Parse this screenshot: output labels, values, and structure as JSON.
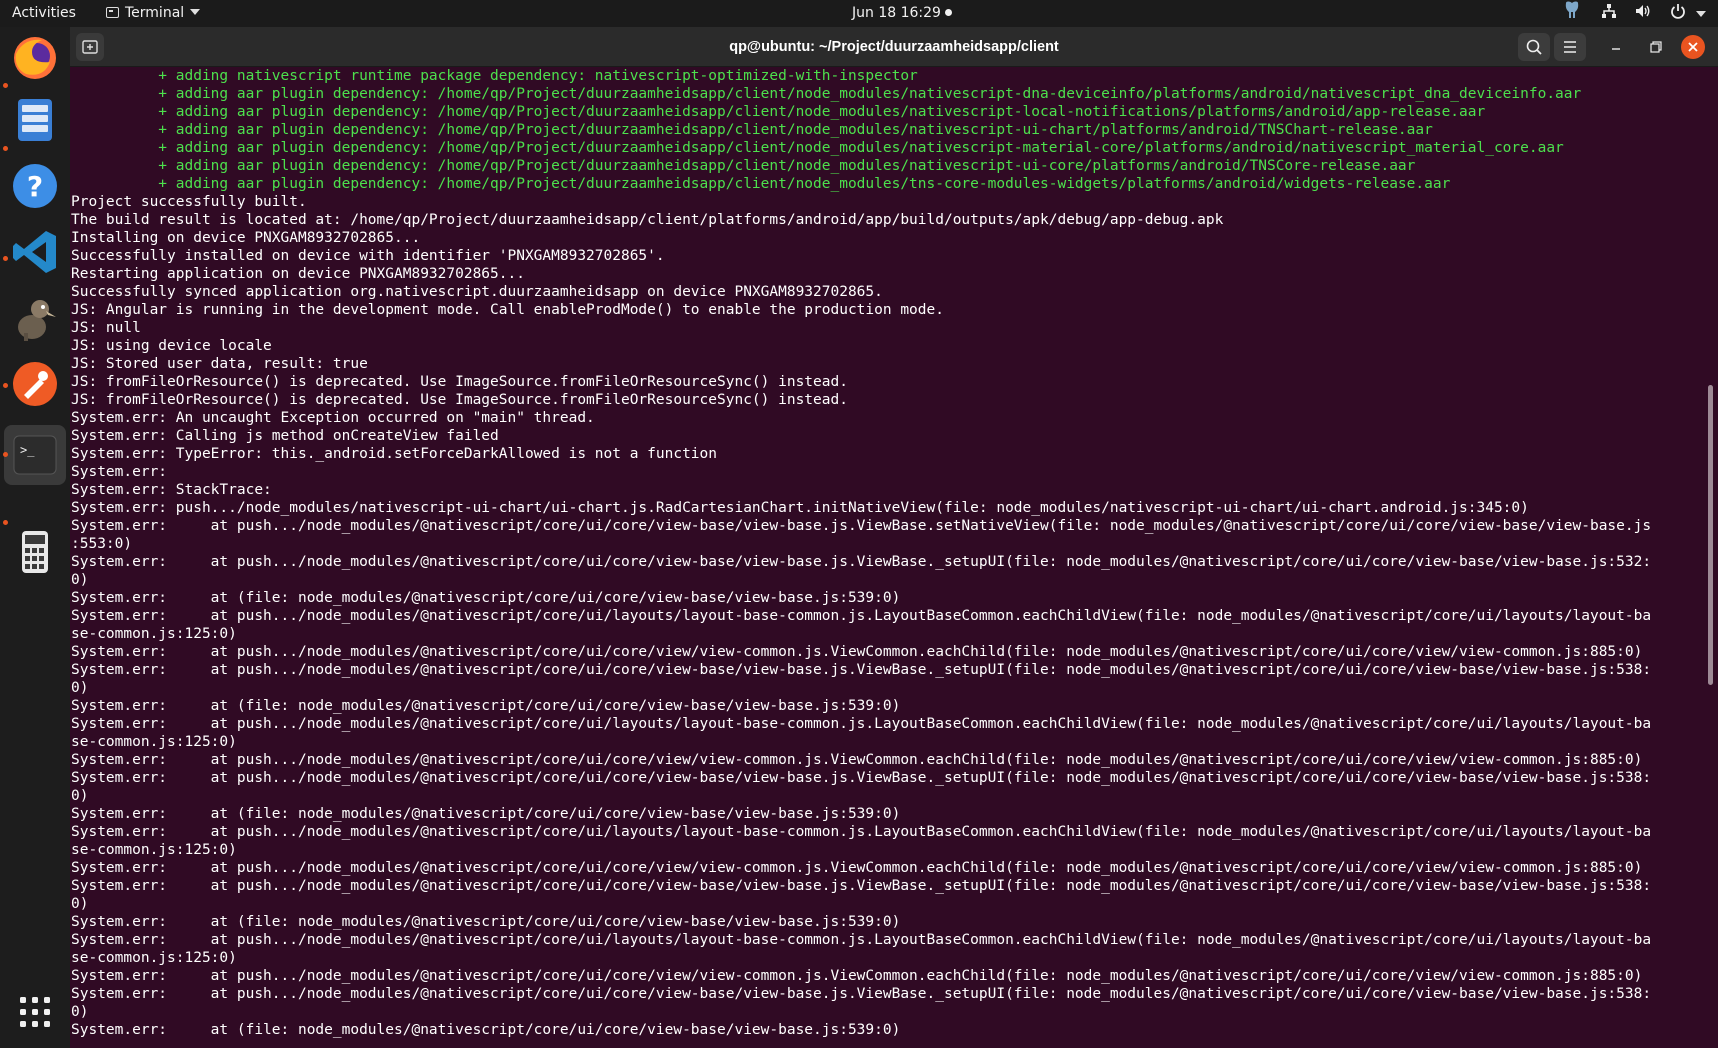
{
  "topbar": {
    "activities": "Activities",
    "app_menu": "Terminal",
    "clock": "Jun 18  16:29"
  },
  "dock": {
    "items": [
      {
        "name": "firefox-icon"
      },
      {
        "name": "files-icon"
      },
      {
        "name": "help-icon"
      },
      {
        "name": "vscode-icon"
      },
      {
        "name": "gimp-icon"
      },
      {
        "name": "postman-icon"
      },
      {
        "name": "terminal-icon"
      },
      {
        "name": "calculator-icon"
      }
    ],
    "show_apps": "show-applications-icon"
  },
  "window": {
    "title": "qp@ubuntu: ~/Project/duurzaamheidsapp/client"
  },
  "colors": {
    "terminal_bg": "#300a24",
    "accent": "#e95420",
    "green_text": "#4de04d"
  },
  "terminal": {
    "lines": [
      {
        "t": "          + adding nativescript runtime package dependency: nativescript-optimized-with-inspector",
        "c": "green"
      },
      {
        "t": "          + adding aar plugin dependency: /home/qp/Project/duurzaamheidsapp/client/node_modules/nativescript-dna-deviceinfo/platforms/android/nativescript_dna_deviceinfo.aar",
        "c": "green"
      },
      {
        "t": "          + adding aar plugin dependency: /home/qp/Project/duurzaamheidsapp/client/node_modules/nativescript-local-notifications/platforms/android/app-release.aar",
        "c": "green"
      },
      {
        "t": "          + adding aar plugin dependency: /home/qp/Project/duurzaamheidsapp/client/node_modules/nativescript-ui-chart/platforms/android/TNSChart-release.aar",
        "c": "green"
      },
      {
        "t": "          + adding aar plugin dependency: /home/qp/Project/duurzaamheidsapp/client/node_modules/nativescript-material-core/platforms/android/nativescript_material_core.aar",
        "c": "green"
      },
      {
        "t": "          + adding aar plugin dependency: /home/qp/Project/duurzaamheidsapp/client/node_modules/nativescript-ui-core/platforms/android/TNSCore-release.aar",
        "c": "green"
      },
      {
        "t": "          + adding aar plugin dependency: /home/qp/Project/duurzaamheidsapp/client/node_modules/tns-core-modules-widgets/platforms/android/widgets-release.aar",
        "c": "green"
      },
      {
        "t": "Project successfully built.",
        "c": "white"
      },
      {
        "t": "The build result is located at: /home/qp/Project/duurzaamheidsapp/client/platforms/android/app/build/outputs/apk/debug/app-debug.apk",
        "c": "white"
      },
      {
        "t": "Installing on device PNXGAM8932702865...",
        "c": "white"
      },
      {
        "t": "Successfully installed on device with identifier 'PNXGAM8932702865'.",
        "c": "white"
      },
      {
        "t": "Restarting application on device PNXGAM8932702865...",
        "c": "white"
      },
      {
        "t": "Successfully synced application org.nativescript.duurzaamheidsapp on device PNXGAM8932702865.",
        "c": "white"
      },
      {
        "t": "JS: Angular is running in the development mode. Call enableProdMode() to enable the production mode.",
        "c": "white"
      },
      {
        "t": "JS: null",
        "c": "white"
      },
      {
        "t": "JS: using device locale",
        "c": "white"
      },
      {
        "t": "JS: Stored user data, result: true",
        "c": "white"
      },
      {
        "t": "JS: fromFileOrResource() is deprecated. Use ImageSource.fromFileOrResourceSync() instead.",
        "c": "white"
      },
      {
        "t": "JS: fromFileOrResource() is deprecated. Use ImageSource.fromFileOrResourceSync() instead.",
        "c": "white"
      },
      {
        "t": "System.err: An uncaught Exception occurred on \"main\" thread.",
        "c": "white"
      },
      {
        "t": "System.err: Calling js method onCreateView failed",
        "c": "white"
      },
      {
        "t": "System.err: TypeError: this._android.setForceDarkAllowed is not a function",
        "c": "white"
      },
      {
        "t": "System.err:",
        "c": "white"
      },
      {
        "t": "System.err: StackTrace:",
        "c": "white"
      },
      {
        "t": "System.err: push.../node_modules/nativescript-ui-chart/ui-chart.js.RadCartesianChart.initNativeView(file: node_modules/nativescript-ui-chart/ui-chart.android.js:345:0)",
        "c": "white"
      },
      {
        "t": "System.err:     at push.../node_modules/@nativescript/core/ui/core/view-base/view-base.js.ViewBase.setNativeView(file: node_modules/@nativescript/core/ui/core/view-base/view-base.js",
        "c": "white"
      },
      {
        "t": ":553:0)",
        "c": "white"
      },
      {
        "t": "System.err:     at push.../node_modules/@nativescript/core/ui/core/view-base/view-base.js.ViewBase._setupUI(file: node_modules/@nativescript/core/ui/core/view-base/view-base.js:532:",
        "c": "white"
      },
      {
        "t": "0)",
        "c": "white"
      },
      {
        "t": "System.err:     at (file: node_modules/@nativescript/core/ui/core/view-base/view-base.js:539:0)",
        "c": "white"
      },
      {
        "t": "System.err:     at push.../node_modules/@nativescript/core/ui/layouts/layout-base-common.js.LayoutBaseCommon.eachChildView(file: node_modules/@nativescript/core/ui/layouts/layout-ba",
        "c": "white"
      },
      {
        "t": "se-common.js:125:0)",
        "c": "white"
      },
      {
        "t": "System.err:     at push.../node_modules/@nativescript/core/ui/core/view/view-common.js.ViewCommon.eachChild(file: node_modules/@nativescript/core/ui/core/view/view-common.js:885:0)",
        "c": "white"
      },
      {
        "t": "System.err:     at push.../node_modules/@nativescript/core/ui/core/view-base/view-base.js.ViewBase._setupUI(file: node_modules/@nativescript/core/ui/core/view-base/view-base.js:538:",
        "c": "white"
      },
      {
        "t": "0)",
        "c": "white"
      },
      {
        "t": "System.err:     at (file: node_modules/@nativescript/core/ui/core/view-base/view-base.js:539:0)",
        "c": "white"
      },
      {
        "t": "System.err:     at push.../node_modules/@nativescript/core/ui/layouts/layout-base-common.js.LayoutBaseCommon.eachChildView(file: node_modules/@nativescript/core/ui/layouts/layout-ba",
        "c": "white"
      },
      {
        "t": "se-common.js:125:0)",
        "c": "white"
      },
      {
        "t": "System.err:     at push.../node_modules/@nativescript/core/ui/core/view/view-common.js.ViewCommon.eachChild(file: node_modules/@nativescript/core/ui/core/view/view-common.js:885:0)",
        "c": "white"
      },
      {
        "t": "System.err:     at push.../node_modules/@nativescript/core/ui/core/view-base/view-base.js.ViewBase._setupUI(file: node_modules/@nativescript/core/ui/core/view-base/view-base.js:538:",
        "c": "white"
      },
      {
        "t": "0)",
        "c": "white"
      },
      {
        "t": "System.err:     at (file: node_modules/@nativescript/core/ui/core/view-base/view-base.js:539:0)",
        "c": "white"
      },
      {
        "t": "System.err:     at push.../node_modules/@nativescript/core/ui/layouts/layout-base-common.js.LayoutBaseCommon.eachChildView(file: node_modules/@nativescript/core/ui/layouts/layout-ba",
        "c": "white"
      },
      {
        "t": "se-common.js:125:0)",
        "c": "white"
      },
      {
        "t": "System.err:     at push.../node_modules/@nativescript/core/ui/core/view/view-common.js.ViewCommon.eachChild(file: node_modules/@nativescript/core/ui/core/view/view-common.js:885:0)",
        "c": "white"
      },
      {
        "t": "System.err:     at push.../node_modules/@nativescript/core/ui/core/view-base/view-base.js.ViewBase._setupUI(file: node_modules/@nativescript/core/ui/core/view-base/view-base.js:538:",
        "c": "white"
      },
      {
        "t": "0)",
        "c": "white"
      },
      {
        "t": "System.err:     at (file: node_modules/@nativescript/core/ui/core/view-base/view-base.js:539:0)",
        "c": "white"
      },
      {
        "t": "System.err:     at push.../node_modules/@nativescript/core/ui/layouts/layout-base-common.js.LayoutBaseCommon.eachChildView(file: node_modules/@nativescript/core/ui/layouts/layout-ba",
        "c": "white"
      },
      {
        "t": "se-common.js:125:0)",
        "c": "white"
      },
      {
        "t": "System.err:     at push.../node_modules/@nativescript/core/ui/core/view/view-common.js.ViewCommon.eachChild(file: node_modules/@nativescript/core/ui/core/view/view-common.js:885:0)",
        "c": "white"
      },
      {
        "t": "System.err:     at push.../node_modules/@nativescript/core/ui/core/view-base/view-base.js.ViewBase._setupUI(file: node_modules/@nativescript/core/ui/core/view-base/view-base.js:538:",
        "c": "white"
      },
      {
        "t": "0)",
        "c": "white"
      },
      {
        "t": "System.err:     at (file: node_modules/@nativescript/core/ui/core/view-base/view-base.js:539:0)",
        "c": "white"
      }
    ]
  }
}
